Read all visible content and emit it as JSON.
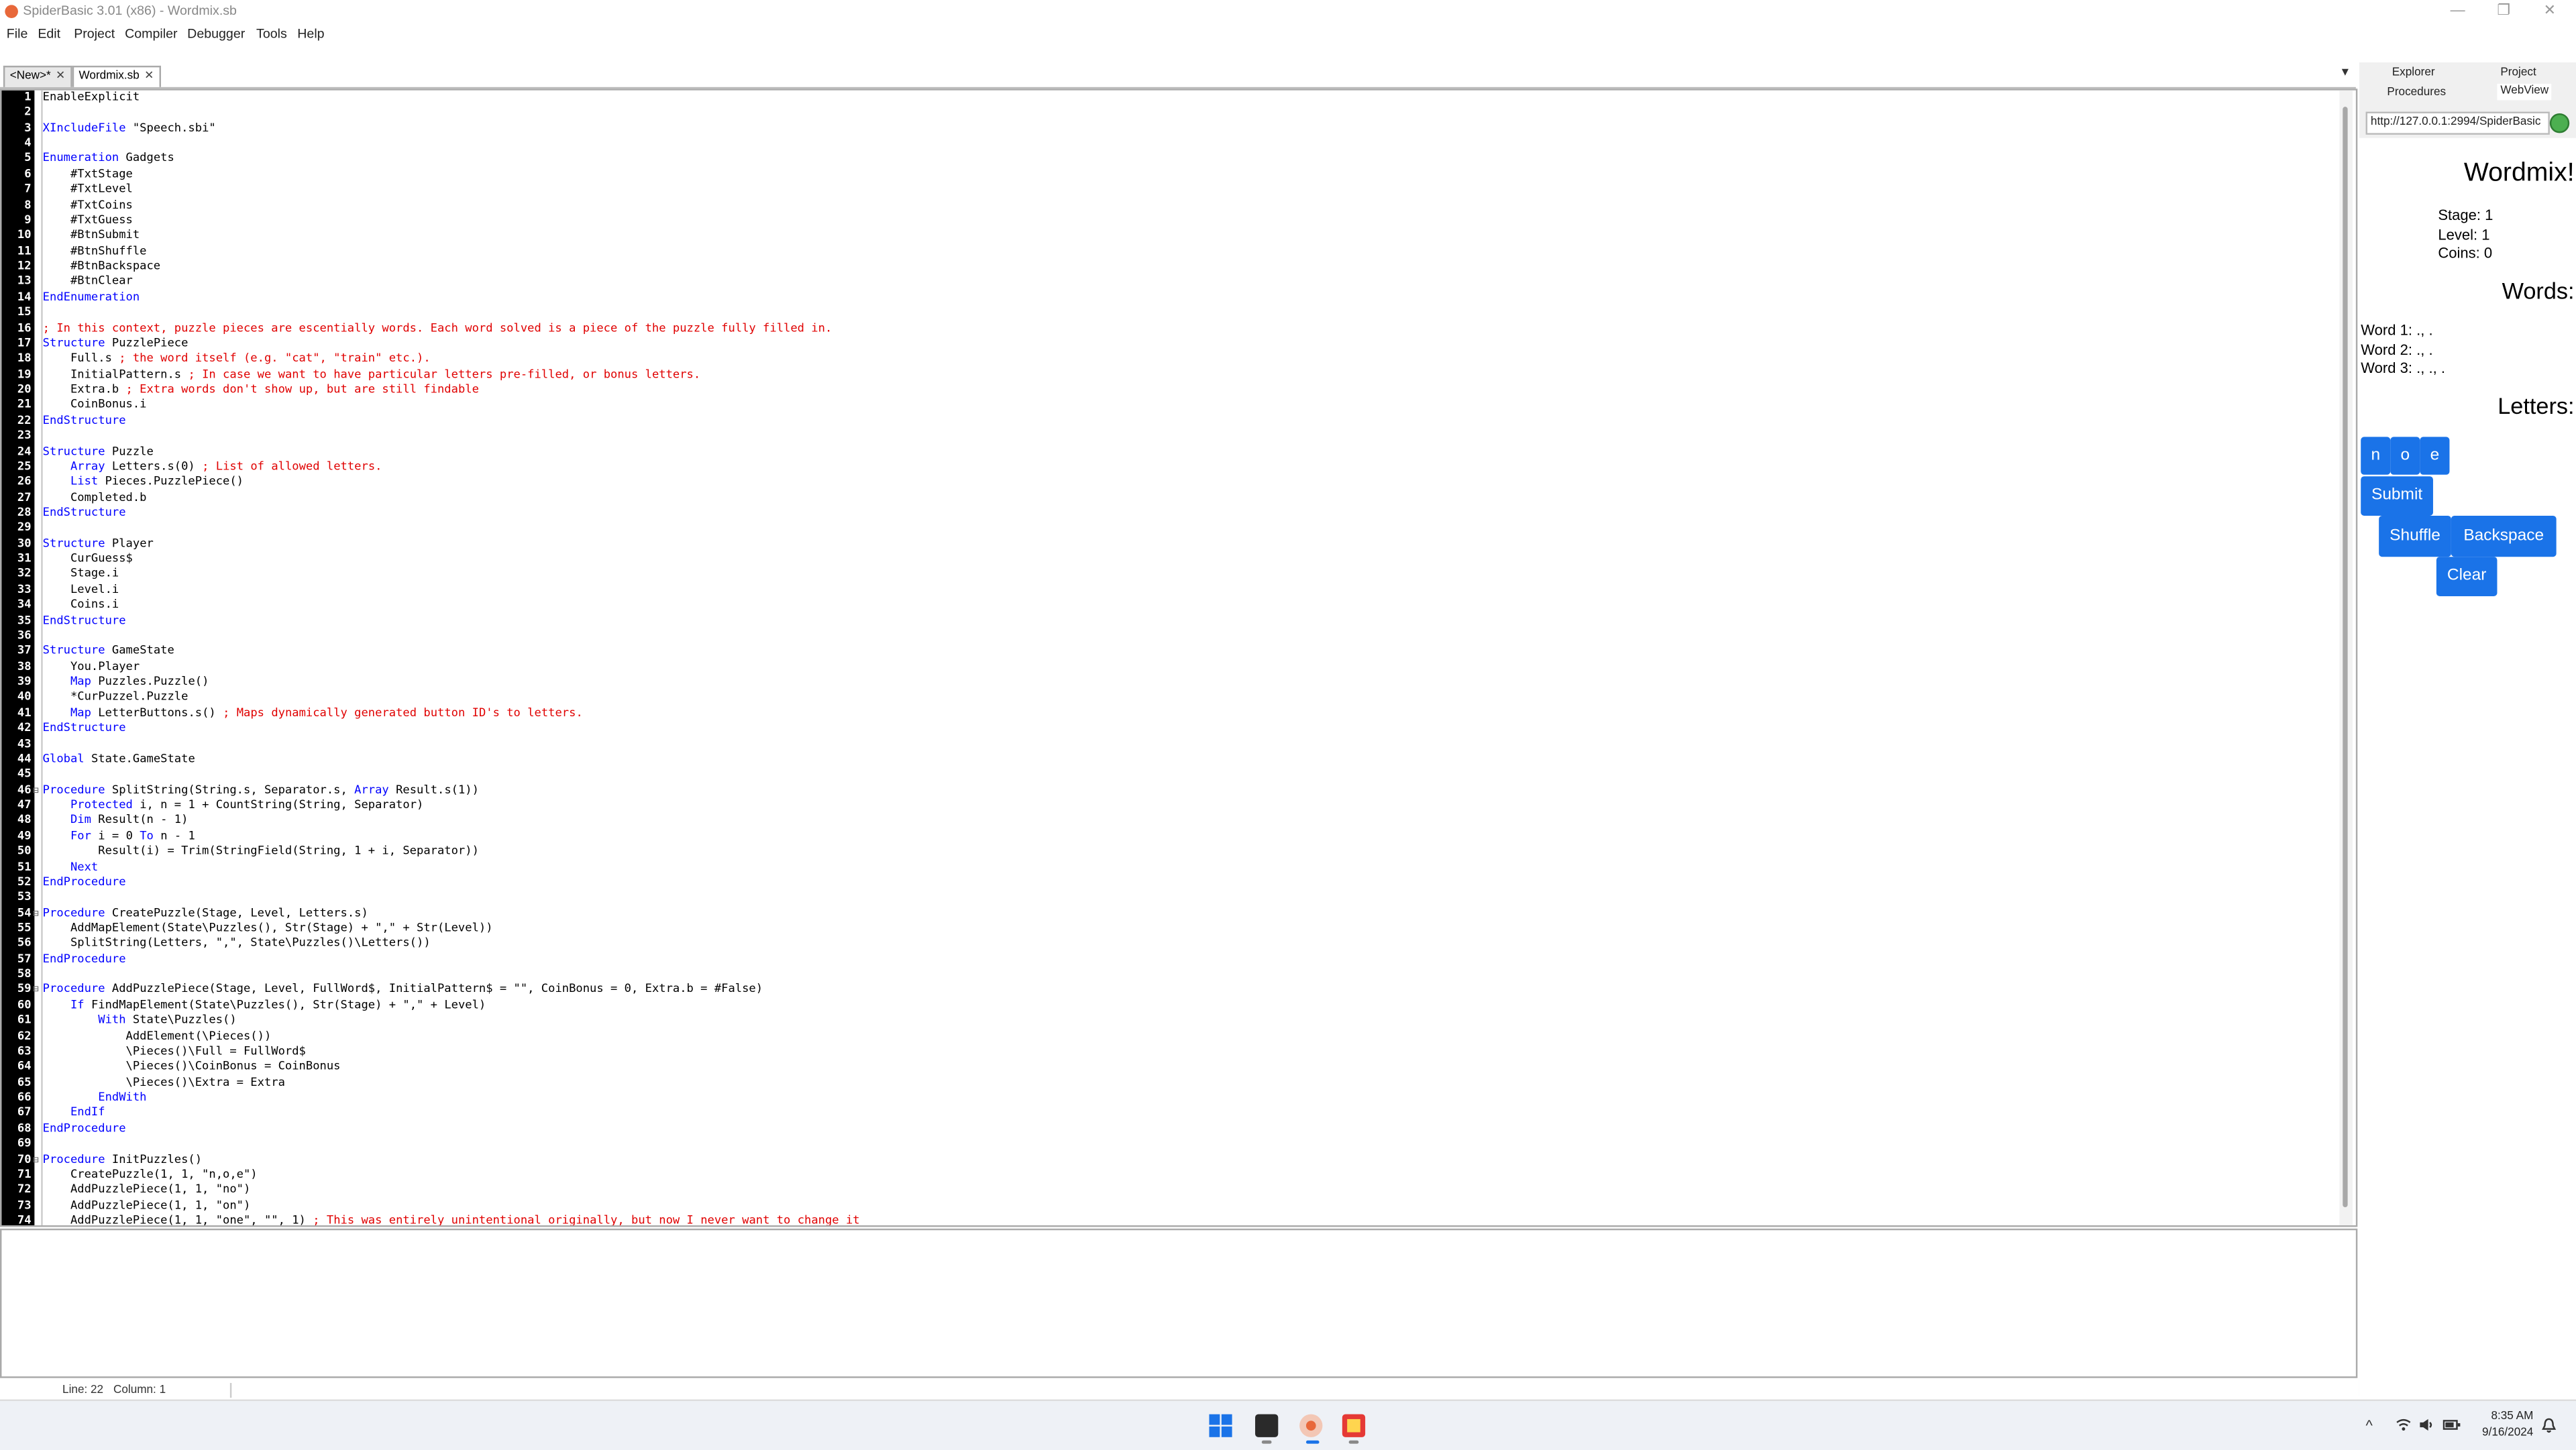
{
  "window": {
    "title": "SpiderBasic 3.01 (x86) - Wordmix.sb",
    "minimize": "—",
    "maximize": "❐",
    "close": "✕"
  },
  "menu": [
    "File",
    "Edit",
    "Project",
    "Compiler",
    "Debugger",
    "Tools",
    "Help"
  ],
  "tabs": [
    {
      "label": "<New>*",
      "close": "✕"
    },
    {
      "label": "Wordmix.sb",
      "close": "✕"
    }
  ],
  "tab_dropdown": "▼",
  "code_lines": [
    {
      "n": "1",
      "fold": "",
      "parts": [
        [
          "n",
          "EnableExplicit"
        ]
      ]
    },
    {
      "n": "2",
      "fold": "",
      "parts": []
    },
    {
      "n": "3",
      "fold": "",
      "parts": [
        [
          "k",
          "XIncludeFile"
        ],
        [
          "n",
          " \"Speech.sbi\""
        ]
      ]
    },
    {
      "n": "4",
      "fold": "",
      "parts": []
    },
    {
      "n": "5",
      "fold": "",
      "parts": [
        [
          "k",
          "Enumeration"
        ],
        [
          "n",
          " Gadgets"
        ]
      ]
    },
    {
      "n": "6",
      "fold": "",
      "parts": [
        [
          "n",
          "    #TxtStage"
        ]
      ]
    },
    {
      "n": "7",
      "fold": "",
      "parts": [
        [
          "n",
          "    #TxtLevel"
        ]
      ]
    },
    {
      "n": "8",
      "fold": "",
      "parts": [
        [
          "n",
          "    #TxtCoins"
        ]
      ]
    },
    {
      "n": "9",
      "fold": "",
      "parts": [
        [
          "n",
          "    #TxtGuess"
        ]
      ]
    },
    {
      "n": "10",
      "fold": "",
      "parts": [
        [
          "n",
          "    #BtnSubmit"
        ]
      ]
    },
    {
      "n": "11",
      "fold": "",
      "parts": [
        [
          "n",
          "    #BtnShuffle"
        ]
      ]
    },
    {
      "n": "12",
      "fold": "",
      "parts": [
        [
          "n",
          "    #BtnBackspace"
        ]
      ]
    },
    {
      "n": "13",
      "fold": "",
      "parts": [
        [
          "n",
          "    #BtnClear"
        ]
      ]
    },
    {
      "n": "14",
      "fold": "",
      "parts": [
        [
          "k",
          "EndEnumeration"
        ]
      ]
    },
    {
      "n": "15",
      "fold": "",
      "parts": []
    },
    {
      "n": "16",
      "fold": "",
      "parts": [
        [
          "c",
          "; In this context, puzzle pieces are escentially words. Each word solved is a piece of the puzzle fully filled in."
        ]
      ]
    },
    {
      "n": "17",
      "fold": "",
      "parts": [
        [
          "k",
          "Structure"
        ],
        [
          "n",
          " PuzzlePiece"
        ]
      ]
    },
    {
      "n": "18",
      "fold": "",
      "parts": [
        [
          "n",
          "    Full.s "
        ],
        [
          "c",
          "; the word itself (e.g. \"cat\", \"train\" etc.)."
        ]
      ]
    },
    {
      "n": "19",
      "fold": "",
      "parts": [
        [
          "n",
          "    InitialPattern.s "
        ],
        [
          "c",
          "; In case we want to have particular letters pre-filled, or bonus letters."
        ]
      ]
    },
    {
      "n": "20",
      "fold": "",
      "parts": [
        [
          "n",
          "    Extra.b "
        ],
        [
          "c",
          "; Extra words don't show up, but are still findable"
        ]
      ]
    },
    {
      "n": "21",
      "fold": "",
      "parts": [
        [
          "n",
          "    CoinBonus.i"
        ]
      ]
    },
    {
      "n": "22",
      "fold": "",
      "parts": [
        [
          "k",
          "EndStructure"
        ]
      ]
    },
    {
      "n": "23",
      "fold": "",
      "parts": []
    },
    {
      "n": "24",
      "fold": "",
      "parts": [
        [
          "k",
          "Structure"
        ],
        [
          "n",
          " Puzzle"
        ]
      ]
    },
    {
      "n": "25",
      "fold": "",
      "parts": [
        [
          "n",
          "    "
        ],
        [
          "k",
          "Array"
        ],
        [
          "n",
          " Letters.s(0) "
        ],
        [
          "c",
          "; List of allowed letters."
        ]
      ]
    },
    {
      "n": "26",
      "fold": "",
      "parts": [
        [
          "n",
          "    "
        ],
        [
          "k",
          "List"
        ],
        [
          "n",
          " Pieces.PuzzlePiece()"
        ]
      ]
    },
    {
      "n": "27",
      "fold": "",
      "parts": [
        [
          "n",
          "    Completed.b"
        ]
      ]
    },
    {
      "n": "28",
      "fold": "",
      "parts": [
        [
          "k",
          "EndStructure"
        ]
      ]
    },
    {
      "n": "29",
      "fold": "",
      "parts": []
    },
    {
      "n": "30",
      "fold": "",
      "parts": [
        [
          "k",
          "Structure"
        ],
        [
          "n",
          " Player"
        ]
      ]
    },
    {
      "n": "31",
      "fold": "",
      "parts": [
        [
          "n",
          "    CurGuess$"
        ]
      ]
    },
    {
      "n": "32",
      "fold": "",
      "parts": [
        [
          "n",
          "    Stage.i"
        ]
      ]
    },
    {
      "n": "33",
      "fold": "",
      "parts": [
        [
          "n",
          "    Level.i"
        ]
      ]
    },
    {
      "n": "34",
      "fold": "",
      "parts": [
        [
          "n",
          "    Coins.i"
        ]
      ]
    },
    {
      "n": "35",
      "fold": "",
      "parts": [
        [
          "k",
          "EndStructure"
        ]
      ]
    },
    {
      "n": "36",
      "fold": "",
      "parts": []
    },
    {
      "n": "37",
      "fold": "",
      "parts": [
        [
          "k",
          "Structure"
        ],
        [
          "n",
          " GameState"
        ]
      ]
    },
    {
      "n": "38",
      "fold": "",
      "parts": [
        [
          "n",
          "    You.Player"
        ]
      ]
    },
    {
      "n": "39",
      "fold": "",
      "parts": [
        [
          "n",
          "    "
        ],
        [
          "k",
          "Map"
        ],
        [
          "n",
          " Puzzles.Puzzle()"
        ]
      ]
    },
    {
      "n": "40",
      "fold": "",
      "parts": [
        [
          "n",
          "    *CurPuzzel.Puzzle"
        ]
      ]
    },
    {
      "n": "41",
      "fold": "",
      "parts": [
        [
          "n",
          "    "
        ],
        [
          "k",
          "Map"
        ],
        [
          "n",
          " LetterButtons.s() "
        ],
        [
          "c",
          "; Maps dynamically generated button ID's to letters."
        ]
      ]
    },
    {
      "n": "42",
      "fold": "",
      "parts": [
        [
          "k",
          "EndStructure"
        ]
      ]
    },
    {
      "n": "43",
      "fold": "",
      "parts": []
    },
    {
      "n": "44",
      "fold": "",
      "parts": [
        [
          "k",
          "Global"
        ],
        [
          "n",
          " State.GameState"
        ]
      ]
    },
    {
      "n": "45",
      "fold": "",
      "parts": []
    },
    {
      "n": "46",
      "fold": "⊟",
      "parts": [
        [
          "k",
          "Procedure"
        ],
        [
          "n",
          " SplitString(String.s, Separator.s, "
        ],
        [
          "k",
          "Array"
        ],
        [
          "n",
          " Result.s(1))"
        ]
      ]
    },
    {
      "n": "47",
      "fold": "",
      "parts": [
        [
          "n",
          "    "
        ],
        [
          "k",
          "Protected"
        ],
        [
          "n",
          " i, n = 1 + CountString(String, Separator)"
        ]
      ]
    },
    {
      "n": "48",
      "fold": "",
      "parts": [
        [
          "n",
          "    "
        ],
        [
          "k",
          "Dim"
        ],
        [
          "n",
          " Result(n - 1)"
        ]
      ]
    },
    {
      "n": "49",
      "fold": "",
      "parts": [
        [
          "n",
          "    "
        ],
        [
          "k",
          "For"
        ],
        [
          "n",
          " i = 0 "
        ],
        [
          "k",
          "To"
        ],
        [
          "n",
          " n - 1"
        ]
      ]
    },
    {
      "n": "50",
      "fold": "",
      "parts": [
        [
          "n",
          "        Result(i) = Trim(StringField(String, 1 + i, Separator))"
        ]
      ]
    },
    {
      "n": "51",
      "fold": "",
      "parts": [
        [
          "n",
          "    "
        ],
        [
          "k",
          "Next"
        ]
      ]
    },
    {
      "n": "52",
      "fold": "",
      "parts": [
        [
          "k",
          "EndProcedure"
        ]
      ]
    },
    {
      "n": "53",
      "fold": "",
      "parts": []
    },
    {
      "n": "54",
      "fold": "⊟",
      "parts": [
        [
          "k",
          "Procedure"
        ],
        [
          "n",
          " CreatePuzzle(Stage, Level, Letters.s)"
        ]
      ]
    },
    {
      "n": "55",
      "fold": "",
      "parts": [
        [
          "n",
          "    AddMapElement(State\\Puzzles(), Str(Stage) + \",\" + Str(Level))"
        ]
      ]
    },
    {
      "n": "56",
      "fold": "",
      "parts": [
        [
          "n",
          "    SplitString(Letters, \",\", State\\Puzzles()\\Letters())"
        ]
      ]
    },
    {
      "n": "57",
      "fold": "",
      "parts": [
        [
          "k",
          "EndProcedure"
        ]
      ]
    },
    {
      "n": "58",
      "fold": "",
      "parts": []
    },
    {
      "n": "59",
      "fold": "⊟",
      "parts": [
        [
          "k",
          "Procedure"
        ],
        [
          "n",
          " AddPuzzlePiece(Stage, Level, FullWord$, InitialPattern$ = \"\", CoinBonus = 0, Extra.b = #False)"
        ]
      ]
    },
    {
      "n": "60",
      "fold": "",
      "parts": [
        [
          "n",
          "    "
        ],
        [
          "k",
          "If"
        ],
        [
          "n",
          " FindMapElement(State\\Puzzles(), Str(Stage) + \",\" + Level)"
        ]
      ]
    },
    {
      "n": "61",
      "fold": "",
      "parts": [
        [
          "n",
          "        "
        ],
        [
          "k",
          "With"
        ],
        [
          "n",
          " State\\Puzzles()"
        ]
      ]
    },
    {
      "n": "62",
      "fold": "",
      "parts": [
        [
          "n",
          "            AddElement(\\Pieces())"
        ]
      ]
    },
    {
      "n": "63",
      "fold": "",
      "parts": [
        [
          "n",
          "            \\Pieces()\\Full = FullWord$"
        ]
      ]
    },
    {
      "n": "64",
      "fold": "",
      "parts": [
        [
          "n",
          "            \\Pieces()\\CoinBonus = CoinBonus"
        ]
      ]
    },
    {
      "n": "65",
      "fold": "",
      "parts": [
        [
          "n",
          "            \\Pieces()\\Extra = Extra"
        ]
      ]
    },
    {
      "n": "66",
      "fold": "",
      "parts": [
        [
          "n",
          "        "
        ],
        [
          "k",
          "EndWith"
        ]
      ]
    },
    {
      "n": "67",
      "fold": "",
      "parts": [
        [
          "n",
          "    "
        ],
        [
          "k",
          "EndIf"
        ]
      ]
    },
    {
      "n": "68",
      "fold": "",
      "parts": [
        [
          "k",
          "EndProcedure"
        ]
      ]
    },
    {
      "n": "69",
      "fold": "",
      "parts": []
    },
    {
      "n": "70",
      "fold": "⊟",
      "parts": [
        [
          "k",
          "Procedure"
        ],
        [
          "n",
          " InitPuzzles()"
        ]
      ]
    },
    {
      "n": "71",
      "fold": "",
      "parts": [
        [
          "n",
          "    CreatePuzzle(1, 1, \"n,o,e\")"
        ]
      ]
    },
    {
      "n": "72",
      "fold": "",
      "parts": [
        [
          "n",
          "    AddPuzzlePiece(1, 1, \"no\")"
        ]
      ]
    },
    {
      "n": "73",
      "fold": "",
      "parts": [
        [
          "n",
          "    AddPuzzlePiece(1, 1, \"on\")"
        ]
      ]
    },
    {
      "n": "74",
      "fold": "",
      "parts": [
        [
          "n",
          "    AddPuzzlePiece(1, 1, \"one\", \"\", 1) "
        ],
        [
          "c",
          "; This was entirely unintentional originally, but now I never want to change it"
        ]
      ]
    }
  ],
  "status": {
    "line": "Line: 22",
    "column": "Column: 1"
  },
  "right_panel": {
    "tabs": [
      "Explorer",
      "Project",
      "Procedures",
      "WebView"
    ],
    "url": "http://127.0.0.1:2994/SpiderBasic",
    "webview": {
      "title": "Wordmix!",
      "stage": "Stage: 1",
      "level": "Level: 1",
      "coins": "Coins: 0",
      "words_heading": "Words:",
      "words": [
        "Word 1: ., .",
        "Word 2: ., .",
        "Word 3: ., ., ."
      ],
      "letters_heading": "Letters:",
      "letters": [
        "n",
        "o",
        "e"
      ],
      "submit": "Submit",
      "shuffle": "Shuffle",
      "backspace": "Backspace",
      "clear": "Clear"
    }
  },
  "taskbar": {
    "time": "8:35 AM",
    "date": "9/16/2024",
    "chevron": "^"
  },
  "colors": {
    "keyword": "#0000ff",
    "comment": "#e00000",
    "button": "#1a73e8",
    "gutter": "#000000"
  }
}
